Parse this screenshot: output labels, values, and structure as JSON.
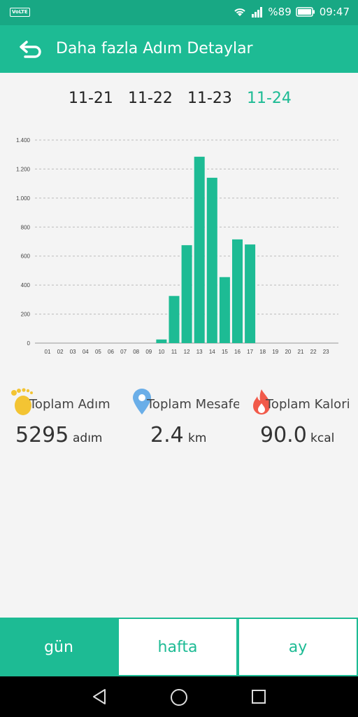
{
  "status_bar": {
    "network": "VoLTE",
    "battery": "%89",
    "time": "09:47"
  },
  "header": {
    "title": "Daha fazla Adım Detaylar"
  },
  "dates": [
    {
      "label": "11-21",
      "selected": false
    },
    {
      "label": "11-22",
      "selected": false
    },
    {
      "label": "11-23",
      "selected": false
    },
    {
      "label": "11-24",
      "selected": true
    }
  ],
  "colors": {
    "accent": "#1dbb94",
    "status_bar": "#18a884",
    "foot_icon": "#f3c433",
    "pin_icon": "#6aaee8",
    "flame_icon": "#f15a4a"
  },
  "chart_data": {
    "type": "bar",
    "categories": [
      "01",
      "02",
      "03",
      "04",
      "05",
      "06",
      "07",
      "08",
      "09",
      "10",
      "11",
      "12",
      "13",
      "14",
      "15",
      "16",
      "17",
      "18",
      "19",
      "20",
      "21",
      "22",
      "23"
    ],
    "values": [
      0,
      0,
      0,
      0,
      0,
      0,
      0,
      0,
      0,
      25,
      325,
      675,
      1285,
      1140,
      455,
      715,
      680,
      0,
      0,
      0,
      0,
      0,
      0
    ],
    "yticks": [
      "0",
      "200",
      "400",
      "600",
      "800",
      "1.000",
      "1.200",
      "1.400"
    ],
    "ylim": [
      0,
      1400
    ],
    "grid": true
  },
  "stats": [
    {
      "icon": "footprint-icon",
      "label": "Toplam Adım",
      "value": "5295",
      "unit": "adım"
    },
    {
      "icon": "location-pin-icon",
      "label": "Toplam Mesafe",
      "value": "2.4",
      "unit": "km"
    },
    {
      "icon": "flame-icon",
      "label": "Toplam Kalori",
      "value": "90.0",
      "unit": "kcal"
    }
  ],
  "tabs": [
    {
      "label": "gün",
      "active": true
    },
    {
      "label": "hafta",
      "active": false
    },
    {
      "label": "ay",
      "active": false
    }
  ]
}
